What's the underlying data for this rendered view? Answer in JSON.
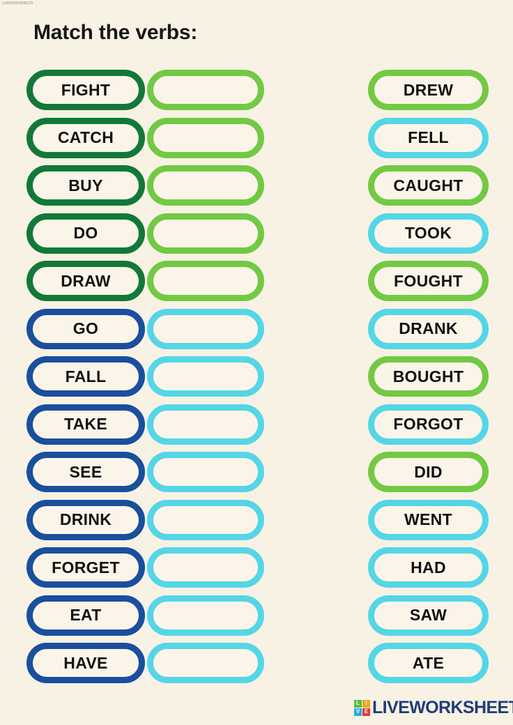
{
  "watermark": "LIVEWORKSHEETS",
  "title": "Match the verbs:",
  "colors": {
    "background": "#f7f2e4",
    "pill_fill": "#faf5e8",
    "dark_green": "#12783a",
    "dark_blue": "#1a4e9e",
    "light_green": "#72c943",
    "cyan": "#54d6e6",
    "text": "#121212",
    "logo_text": "#1f3d7a"
  },
  "rows": [
    {
      "verb": "FIGHT",
      "verb_color": "dark_green",
      "drop_color": "light_green",
      "drop_value": "",
      "past": "DREW",
      "past_color": "light_green"
    },
    {
      "verb": "CATCH",
      "verb_color": "dark_green",
      "drop_color": "light_green",
      "drop_value": "",
      "past": "FELL",
      "past_color": "cyan"
    },
    {
      "verb": "BUY",
      "verb_color": "dark_green",
      "drop_color": "light_green",
      "drop_value": "",
      "past": "CAUGHT",
      "past_color": "light_green"
    },
    {
      "verb": "DO",
      "verb_color": "dark_green",
      "drop_color": "light_green",
      "drop_value": "",
      "past": "TOOK",
      "past_color": "cyan"
    },
    {
      "verb": "DRAW",
      "verb_color": "dark_green",
      "drop_color": "light_green",
      "drop_value": "",
      "past": "FOUGHT",
      "past_color": "light_green"
    },
    {
      "verb": "GO",
      "verb_color": "dark_blue",
      "drop_color": "cyan",
      "drop_value": "",
      "past": "DRANK",
      "past_color": "cyan"
    },
    {
      "verb": "FALL",
      "verb_color": "dark_blue",
      "drop_color": "cyan",
      "drop_value": "",
      "past": "BOUGHT",
      "past_color": "light_green"
    },
    {
      "verb": "TAKE",
      "verb_color": "dark_blue",
      "drop_color": "cyan",
      "drop_value": "",
      "past": "FORGOT",
      "past_color": "cyan"
    },
    {
      "verb": "SEE",
      "verb_color": "dark_blue",
      "drop_color": "cyan",
      "drop_value": "",
      "past": "DID",
      "past_color": "light_green"
    },
    {
      "verb": "DRINK",
      "verb_color": "dark_blue",
      "drop_color": "cyan",
      "drop_value": "",
      "past": "WENT",
      "past_color": "cyan"
    },
    {
      "verb": "FORGET",
      "verb_color": "dark_blue",
      "drop_color": "cyan",
      "drop_value": "",
      "past": "HAD",
      "past_color": "cyan"
    },
    {
      "verb": "EAT",
      "verb_color": "dark_blue",
      "drop_color": "cyan",
      "drop_value": "",
      "past": "SAW",
      "past_color": "cyan"
    },
    {
      "verb": "HAVE",
      "verb_color": "dark_blue",
      "drop_color": "cyan",
      "drop_value": "",
      "past": "ATE",
      "past_color": "cyan"
    }
  ],
  "logo": {
    "mark_letters": [
      "L",
      "I",
      "V",
      "E"
    ],
    "wordmark": "LIVEWORKSHEETS"
  }
}
